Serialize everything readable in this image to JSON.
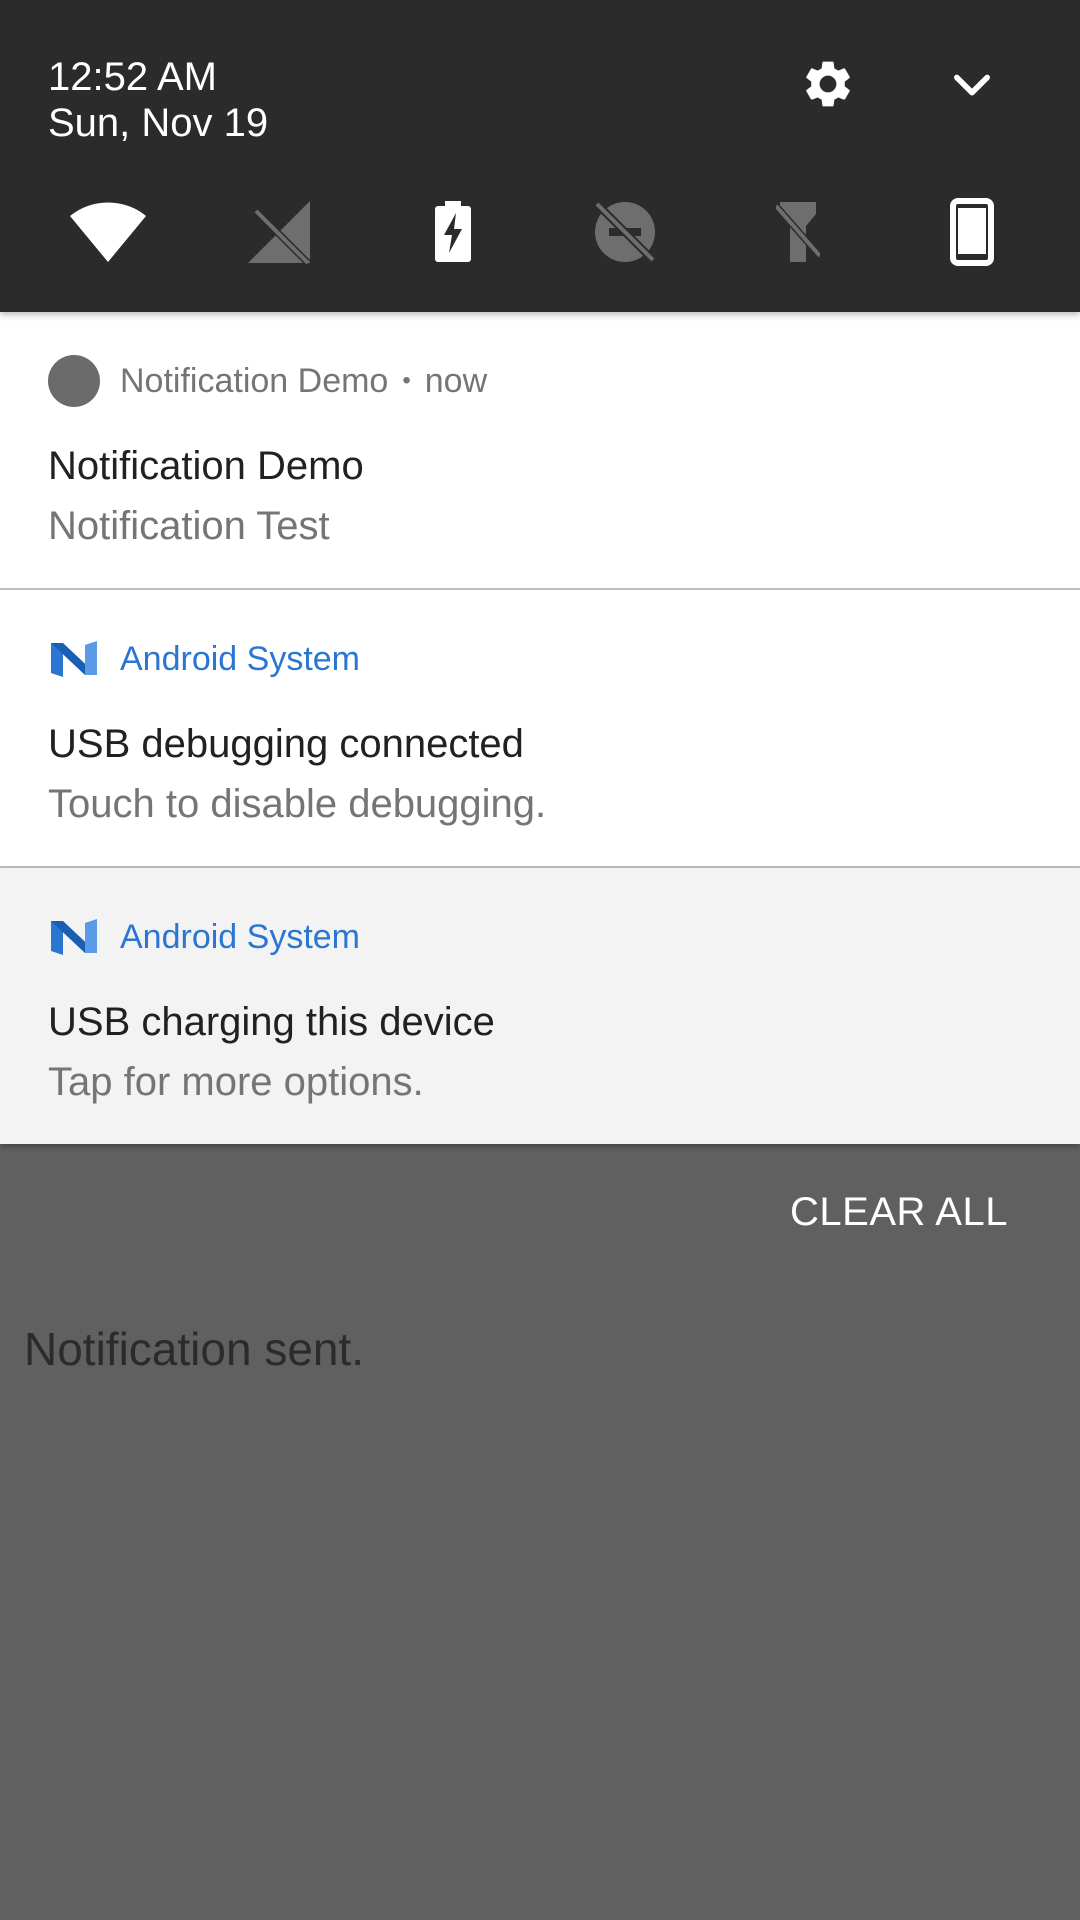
{
  "header": {
    "time": "12:52 AM",
    "date": "Sun, Nov 19",
    "settings_icon": "gear-icon",
    "expand_icon": "chevron-down-icon"
  },
  "quick_tiles": [
    {
      "name": "wifi",
      "icon": "wifi-icon",
      "state": "on"
    },
    {
      "name": "mobile-data",
      "icon": "no-signal-icon",
      "state": "off"
    },
    {
      "name": "battery",
      "icon": "battery-charging-icon",
      "state": "on"
    },
    {
      "name": "do-not-disturb",
      "icon": "dnd-off-icon",
      "state": "off"
    },
    {
      "name": "flashlight",
      "icon": "flashlight-off-icon",
      "state": "off"
    },
    {
      "name": "rotation",
      "icon": "phone-portrait-icon",
      "state": "on"
    }
  ],
  "notifications": [
    {
      "app": "Notification Demo",
      "separator": "•",
      "time": "now",
      "title": "Notification Demo",
      "text": "Notification Test"
    },
    {
      "app": "Android System",
      "title": "USB debugging connected",
      "text": "Touch to disable debugging."
    },
    {
      "app": "Android System",
      "title": "USB charging this device",
      "text": "Tap for more options."
    }
  ],
  "clear_all_label": "CLEAR ALL",
  "app_message": "Notification sent.",
  "colors": {
    "header_bg": "#2b2b2b",
    "scrim": "#606060",
    "accent_blue": "#2a76d2"
  }
}
